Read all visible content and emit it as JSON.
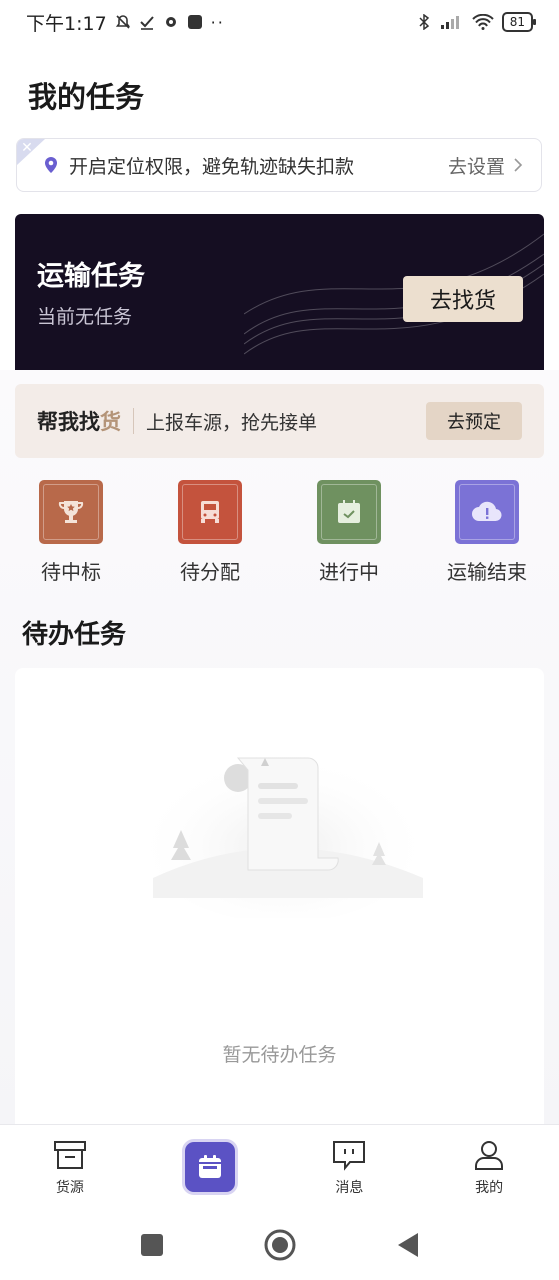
{
  "status_bar": {
    "time": "下午1:17",
    "battery": "81"
  },
  "page": {
    "title": "我的任务"
  },
  "location_banner": {
    "message": "开启定位权限，避免轨迹缺失扣款",
    "action": "去设置"
  },
  "transport_card": {
    "title": "运输任务",
    "subtitle": "当前无任务",
    "button": "去找货"
  },
  "helper_bar": {
    "brand_prefix": "帮我找",
    "brand_highlight": "货",
    "text": "上报车源，抢先接单",
    "button": "去预定"
  },
  "categories": [
    {
      "label": "待中标",
      "icon": "trophy-icon",
      "color": "#b8694a"
    },
    {
      "label": "待分配",
      "icon": "truck-icon",
      "color": "#c4533d"
    },
    {
      "label": "进行中",
      "icon": "calendar-check-icon",
      "color": "#6f9160"
    },
    {
      "label": "运输结束",
      "icon": "cloud-alert-icon",
      "color": "#7b72d6"
    }
  ],
  "todo": {
    "title": "待办任务",
    "empty_text": "暂无待办任务"
  },
  "tabbar": [
    {
      "label": "货源",
      "icon": "box-icon"
    },
    {
      "label": "",
      "icon": "calendar-icon"
    },
    {
      "label": "消息",
      "icon": "message-icon"
    },
    {
      "label": "我的",
      "icon": "user-icon"
    }
  ],
  "colors": {
    "accent": "#5b52c4",
    "dark_card": "#150e22",
    "gold_button": "#ecdfcf"
  }
}
